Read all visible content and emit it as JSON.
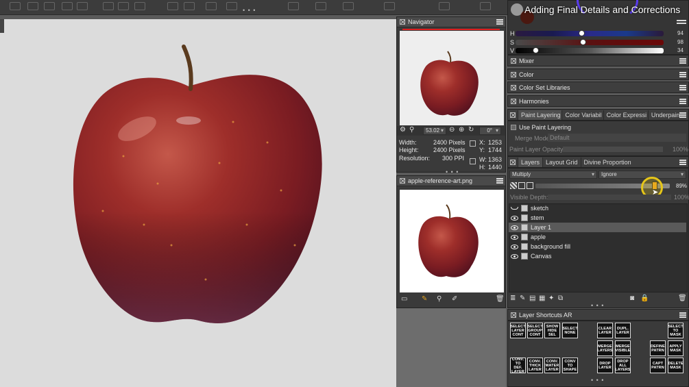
{
  "video_title": "Adding Final Details and Corrections",
  "navigator": {
    "title": "Navigator",
    "zoom": "53.02",
    "rotation": "0°",
    "width_label": "Width:",
    "width_value": "2400 Pixels",
    "height_label": "Height:",
    "height_value": "2400 Pixels",
    "resolution_label": "Resolution:",
    "resolution_value": "300 PPI",
    "x_label": "X:",
    "x_value": "1253",
    "y_label": "Y:",
    "y_value": "1744",
    "w_label": "W:",
    "w_value": "1363",
    "h_label": "H:",
    "h_value": "1440"
  },
  "reference": {
    "title": "apple-reference-art.png"
  },
  "color_sliders": [
    {
      "label": "H",
      "value": "94",
      "level": 0.45
    },
    {
      "label": "S",
      "value": "98",
      "level": 0.46
    },
    {
      "label": "V",
      "value": "34",
      "level": 0.14
    }
  ],
  "panels": {
    "mixer": "Mixer",
    "color": "Color",
    "color_set_libraries": "Color Set Libraries",
    "harmonies": "Harmonies"
  },
  "paint_layering": {
    "tabs": [
      "Paint Layering",
      "Color Variabil",
      "Color Expressi",
      "Underpaintir"
    ],
    "use_label": "Use Paint Layering",
    "merge_mode_label": "Merge Mode:",
    "merge_mode_value": "Default",
    "opacity_label": "Paint Layer Opacity:",
    "opacity_value": "100%"
  },
  "layers": {
    "tabs": [
      "Layers",
      "Layout Grid",
      "Divine Proportion"
    ],
    "blend_mode": "Multiply",
    "composite": "Ignore",
    "opacity_value": "89%",
    "opacity_level": 0.89,
    "visible_depth_label": "Visible Depth:",
    "visible_depth_value": "100%",
    "items": [
      {
        "name": "sketch",
        "visible": false,
        "selected": false
      },
      {
        "name": "stem",
        "visible": true,
        "selected": false
      },
      {
        "name": "Layer 1",
        "visible": true,
        "selected": true
      },
      {
        "name": "apple",
        "visible": true,
        "selected": false
      },
      {
        "name": "background fill",
        "visible": true,
        "selected": false
      },
      {
        "name": "Canvas",
        "visible": true,
        "selected": false
      }
    ]
  },
  "shortcuts": {
    "title": "Layer Shortcuts AR",
    "buttons": [
      "SELECT LAYER CONT",
      "SELECT GROUP CONT",
      "SHOW HIDE SEL",
      "SELECT NONE",
      "CLEAR LAYER",
      "DUPL. LAYER",
      "SELECT TO MASK",
      "MERGE LAYERS",
      "MERGE VISIBLE",
      "DEFINE PATRN",
      "APPLY MASK",
      "CONV. TO DEF. LAYER",
      "CONV. THICK LAYER",
      "CONV. WATER LAYER",
      "CONV TO SHAPE",
      "DROP LAYER",
      "DROP ALL LAYERS",
      "CAPT PATRN",
      "DELETE MASK"
    ]
  },
  "colors": {
    "apple_red": "#8e2424",
    "panel_bg": "#3a3a3a",
    "canvas_bg": "#dcdcdc",
    "highlight": "#e6c619"
  }
}
